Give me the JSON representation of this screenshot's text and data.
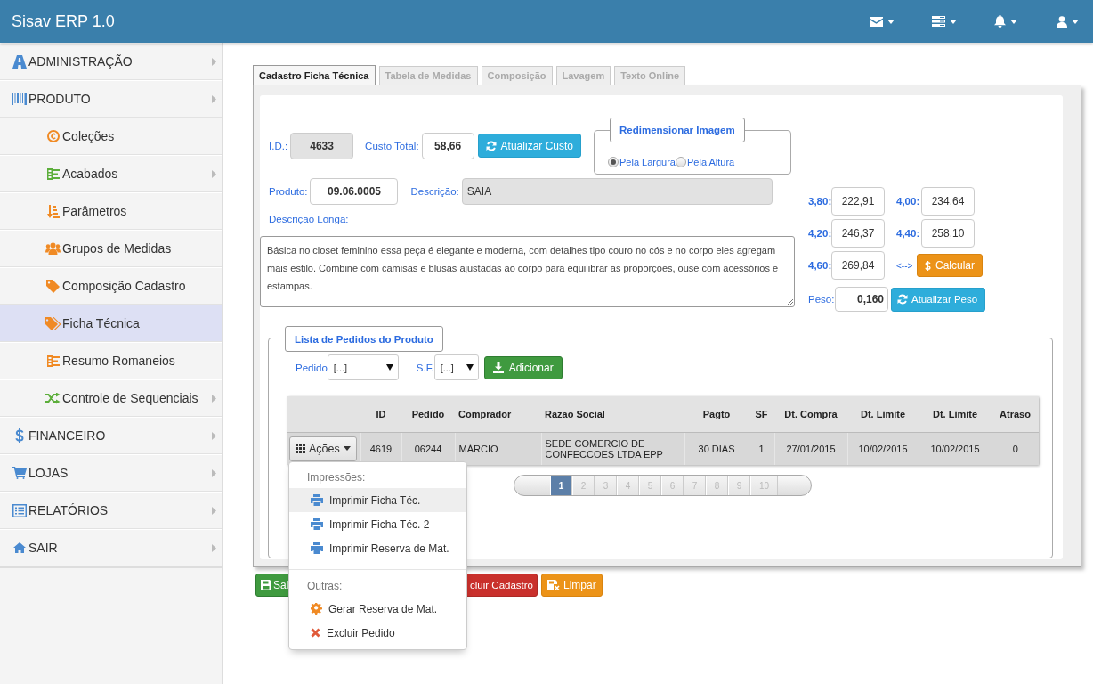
{
  "app": {
    "title": "Sisav ERP 1.0"
  },
  "sidebar": {
    "items": [
      {
        "label": "ADMINISTRAÇÃO",
        "has_submenu": true,
        "selected": false
      },
      {
        "label": "PRODUTO",
        "has_submenu": true,
        "selected": false,
        "children": [
          {
            "label": "Coleções",
            "has_submenu": false,
            "selected": false
          },
          {
            "label": "Acabados",
            "has_submenu": true,
            "selected": false
          },
          {
            "label": "Parâmetros",
            "has_submenu": false,
            "selected": false
          },
          {
            "label": "Grupos de Medidas",
            "has_submenu": false,
            "selected": false
          },
          {
            "label": "Composição Cadastro",
            "has_submenu": false,
            "selected": false
          },
          {
            "label": "Ficha Técnica",
            "has_submenu": false,
            "selected": true
          },
          {
            "label": "Resumo Romaneios",
            "has_submenu": false,
            "selected": false
          },
          {
            "label": "Controle de Sequenciais",
            "has_submenu": true,
            "selected": false
          }
        ]
      },
      {
        "label": "FINANCEIRO",
        "has_submenu": true,
        "selected": false
      },
      {
        "label": "LOJAS",
        "has_submenu": true,
        "selected": false
      },
      {
        "label": "RELATÓRIOS",
        "has_submenu": true,
        "selected": false
      },
      {
        "label": "SAIR",
        "has_submenu": true,
        "selected": false
      }
    ]
  },
  "tabs": [
    {
      "label": "Cadastro Ficha Técnica",
      "selected": true
    },
    {
      "label": "Tabela de Medidas",
      "selected": false
    },
    {
      "label": "Composição",
      "selected": false
    },
    {
      "label": "Lavagem",
      "selected": false
    },
    {
      "label": "Texto Online",
      "selected": false
    }
  ],
  "form": {
    "id": {
      "label": "I.D.:",
      "value": "4633",
      "readonly": true
    },
    "cost": {
      "label": "Custo Total:",
      "value": "58,66",
      "readonly": false
    },
    "update_cost_button": "Atualizar Custo",
    "product": {
      "label": "Produto:",
      "value": "09.06.0005",
      "readonly": false
    },
    "description": {
      "label": "Descrição:",
      "value": "SAIA",
      "readonly": true
    },
    "long_description": {
      "label": "Descrição Longa:",
      "value": "Básica no closet feminino essa peça é elegante e moderna, com detalhes tipo couro no cós e no corpo eles agregam mais estilo. Combine com camisas e blusas ajustadas ao corpo para equilibrar as proporções, ouse com acessórios e estampas."
    }
  },
  "resize": {
    "legend": "Redimensionar Imagem",
    "options": [
      {
        "label": "Pela Largura",
        "selected": true
      },
      {
        "label": "Pela Altura",
        "selected": false
      }
    ]
  },
  "sizes": [
    {
      "label": "3,80:",
      "value": "222,91"
    },
    {
      "label": "4,00:",
      "value": "234,64"
    },
    {
      "label": "4,20:",
      "value": "246,37"
    },
    {
      "label": "4,40:",
      "value": "258,10"
    },
    {
      "label": "4,60:",
      "value": "269,84"
    }
  ],
  "swap_label": "<-->",
  "calculate_button": "Calcular",
  "weight": {
    "label": "Peso:",
    "value": "0,160"
  },
  "update_weight_button": "Atualizar Peso",
  "orders": {
    "legend": "Lista de Pedidos do Produto",
    "filters": [
      {
        "label": "Pedido",
        "value": "[...]"
      },
      {
        "label": "S.F.",
        "value": "[...]"
      }
    ],
    "add_button": "Adicionar",
    "table": {
      "columns": [
        "ID",
        "Pedido",
        "Comprador",
        "Razão Social",
        "Pagto",
        "SF",
        "Dt. Compra",
        "Dt. Limite",
        "Dt. Limite",
        "Atraso"
      ],
      "rows": [
        {
          "actions": "Ações",
          "cells": [
            "4619",
            "06244",
            "MÁRCIO",
            "SEDE COMERCIO DE CONFECCOES LTDA EPP",
            "30 DIAS",
            "1",
            "27/01/2015",
            "10/02/2015",
            "10/02/2015",
            "0"
          ]
        }
      ]
    },
    "pagination": {
      "pages": [
        {
          "label": "1",
          "selected": true
        },
        {
          "label": "2",
          "selected": false
        },
        {
          "label": "3",
          "selected": false
        },
        {
          "label": "4",
          "selected": false
        },
        {
          "label": "5",
          "selected": false
        },
        {
          "label": "6",
          "selected": false
        },
        {
          "label": "7",
          "selected": false
        },
        {
          "label": "8",
          "selected": false
        },
        {
          "label": "9",
          "selected": false
        },
        {
          "label": "10",
          "selected": false
        }
      ]
    }
  },
  "actions_menu": {
    "sections": [
      {
        "header": "Impressões:",
        "items": [
          {
            "label": "Imprimir Ficha Téc.",
            "selected": true
          },
          {
            "label": "Imprimir Ficha Téc. 2",
            "selected": false
          },
          {
            "label": "Imprimir Reserva de Mat.",
            "selected": false
          }
        ]
      },
      {
        "header": "Outras:",
        "items": [
          {
            "label": "Gerar Reserva de Mat.",
            "selected": false
          },
          {
            "label": "Excluir Pedido",
            "selected": false
          }
        ]
      }
    ]
  },
  "footer_buttons": [
    {
      "label": "Sal",
      "kind": "success"
    },
    {
      "label": "cluir Cadastro",
      "kind": "danger"
    },
    {
      "label": "Limpar",
      "kind": "warning"
    }
  ]
}
